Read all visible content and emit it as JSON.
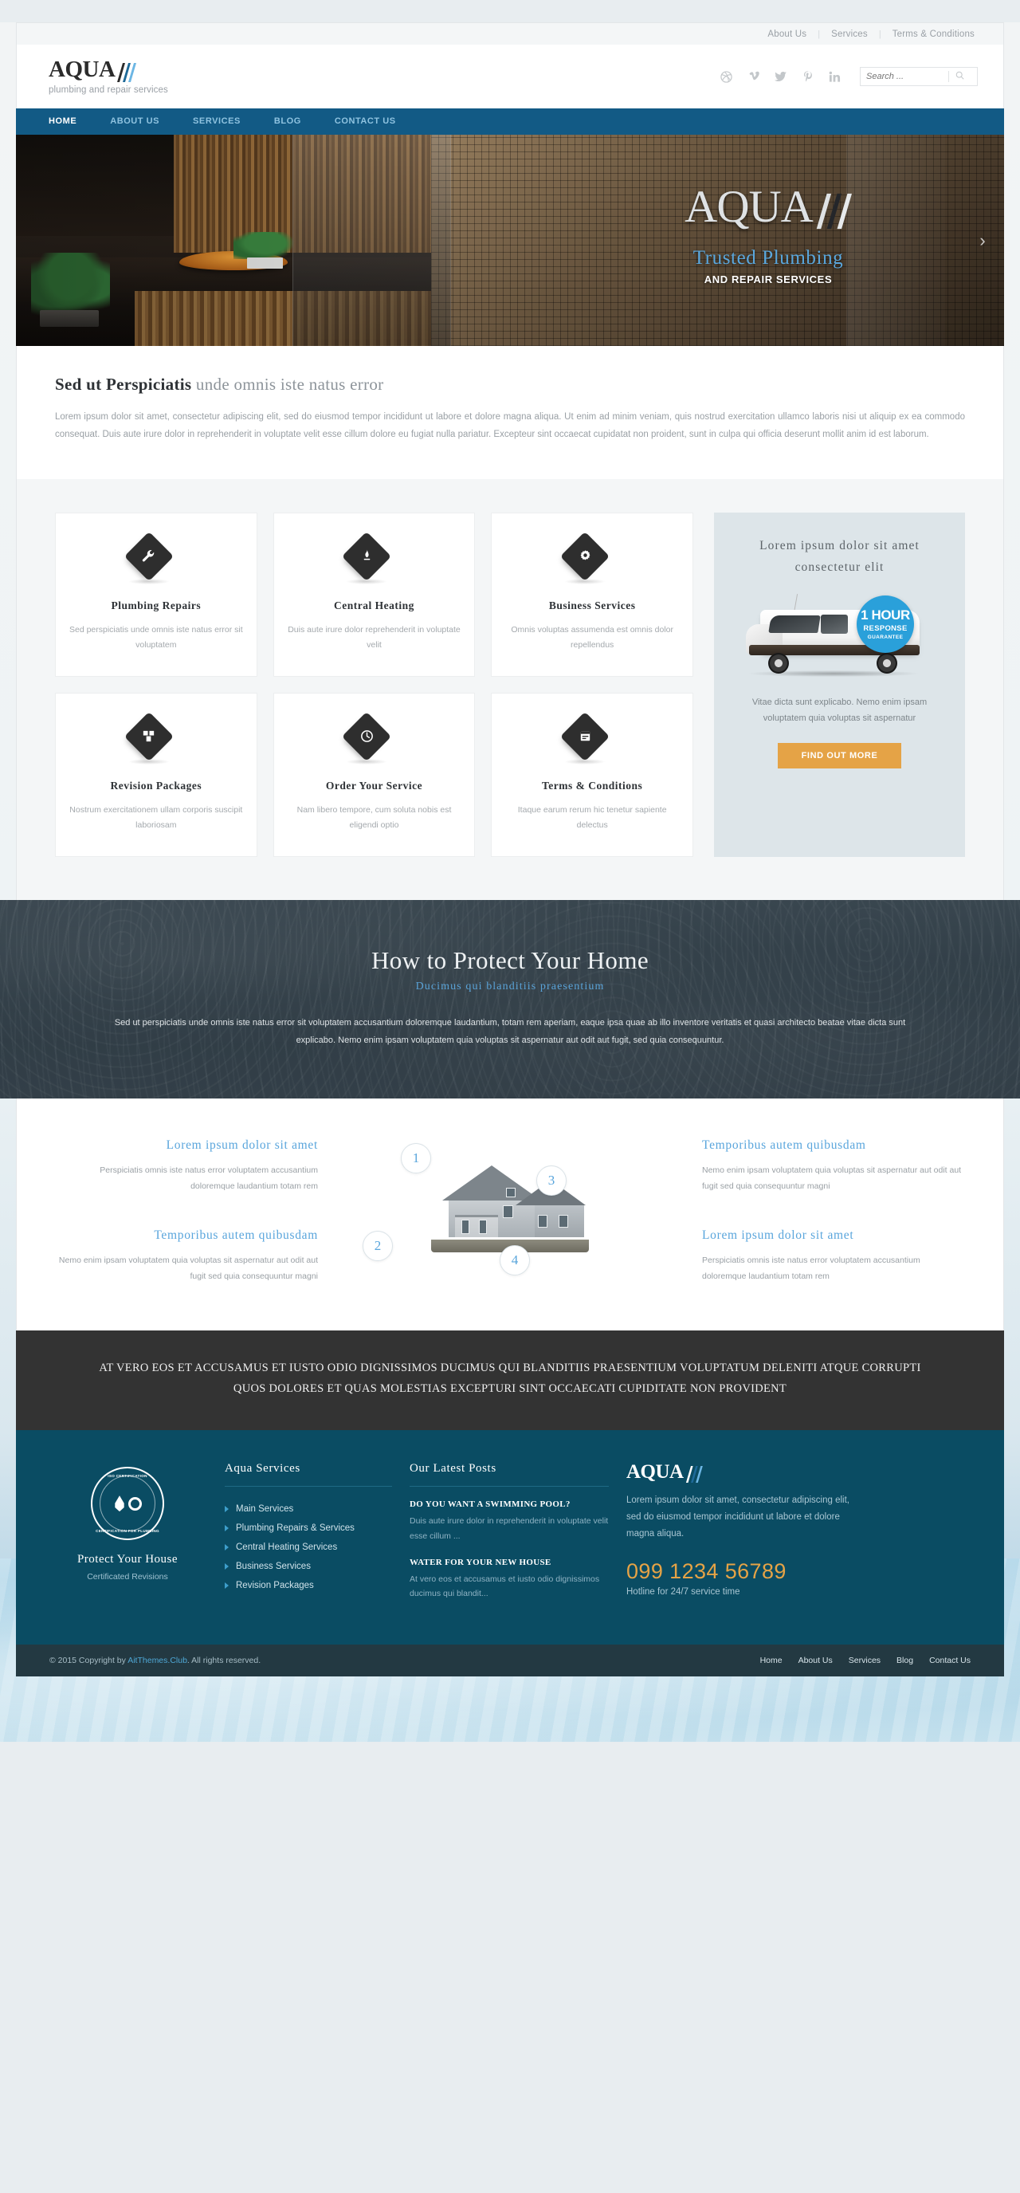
{
  "topbar": {
    "links": [
      "About Us",
      "Services",
      "Terms & Conditions"
    ]
  },
  "header": {
    "logo_text": "AQUA",
    "tagline": "plumbing and repair services",
    "social": [
      "dribbble-icon",
      "vimeo-icon",
      "twitter-icon",
      "pinterest-icon",
      "linkedin-icon"
    ],
    "search_placeholder": "Search ...",
    "search_value": ""
  },
  "nav": {
    "items": [
      {
        "label": "HOME",
        "active": true
      },
      {
        "label": "ABOUT US",
        "active": false
      },
      {
        "label": "SERVICES",
        "active": false
      },
      {
        "label": "BLOG",
        "active": false
      },
      {
        "label": "CONTACT US",
        "active": false
      }
    ]
  },
  "hero": {
    "logo_text": "AQUA",
    "headline": "Trusted Plumbing",
    "subhead": "AND REPAIR SERVICES",
    "next_arrow": "chevron-right-icon"
  },
  "intro": {
    "title_bold": "Sed ut Perspiciatis",
    "title_rest": " unde omnis iste natus error",
    "body": "Lorem ipsum dolor sit amet, consectetur adipiscing elit, sed do eiusmod tempor incididunt ut labore et dolore magna aliqua. Ut enim ad minim veniam, quis nostrud exercitation ullamco laboris nisi ut aliquip ex ea commodo consequat. Duis aute irure dolor in reprehenderit in voluptate velit esse cillum dolore eu fugiat nulla pariatur. Excepteur sint occaecat cupidatat non proident, sunt in culpa qui officia deserunt mollit anim id est laborum."
  },
  "services": {
    "cards": [
      {
        "icon": "wrench-icon",
        "title": "Plumbing Repairs",
        "text": "Sed perspiciatis unde omnis iste natus error sit voluptatem"
      },
      {
        "icon": "flame-icon",
        "title": "Central Heating",
        "text": "Duis aute irure dolor reprehenderit in voluptate velit"
      },
      {
        "icon": "gear-icon",
        "title": "Business Services",
        "text": "Omnis voluptas assumenda est omnis dolor repellendus"
      },
      {
        "icon": "puzzle-icon",
        "title": "Revision Packages",
        "text": "Nostrum exercitationem ullam corporis suscipit laboriosam"
      },
      {
        "icon": "clock-icon",
        "title": "Order Your Service",
        "text": "Nam libero tempore, cum soluta nobis est eligendi optio"
      },
      {
        "icon": "document-icon",
        "title": "Terms & Conditions",
        "text": "Itaque earum rerum hic tenetur sapiente delectus"
      }
    ]
  },
  "promo": {
    "title_line1": "Lorem ipsum dolor sit amet",
    "title_line2": "consectetur elit",
    "badge_line1": "1 HOUR",
    "badge_line2": "RESPONSE",
    "badge_line3": "GUARANTEE",
    "text": "Vitae dicta sunt explicabo. Nemo enim ipsam voluptatem quia voluptas sit aspernatur",
    "button": "FIND OUT MORE"
  },
  "dark_section": {
    "title": "How to Protect Your Home",
    "subtitle": "Ducimus qui blanditiis praesentium",
    "body": "Sed ut perspiciatis unde omnis iste natus error sit voluptatem accusantium doloremque laudantium, totam rem aperiam, eaque ipsa quae ab illo inventore veritatis et quasi architecto beatae vitae dicta sunt explicabo. Nemo enim ipsam voluptatem quia voluptas sit aspernatur aut odit aut fugit, sed quia consequuntur."
  },
  "house_section": {
    "left": [
      {
        "title": "Lorem ipsum dolor sit amet",
        "text": "Perspiciatis omnis iste natus error voluptatem accusantium doloremque laudantium totam rem"
      },
      {
        "title": "Temporibus autem quibusdam",
        "text": "Nemo enim ipsam voluptatem quia voluptas sit aspernatur aut odit aut fugit sed quia consequuntur magni"
      }
    ],
    "right": [
      {
        "title": "Temporibus autem quibusdam",
        "text": "Nemo enim ipsam voluptatem quia voluptas sit aspernatur aut odit aut fugit sed quia consequuntur magni"
      },
      {
        "title": "Lorem ipsum dolor sit amet",
        "text": "Perspiciatis omnis iste natus error voluptatem accusantium doloremque laudantium totam rem"
      }
    ],
    "markers": [
      "1",
      "2",
      "3",
      "4"
    ]
  },
  "quote_bar": {
    "text": "At vero eos et accusamus et iusto odio dignissimos ducimus qui blanditiis praesentium voluptatum deleniti atque corrupti quos dolores et quas molestias excepturi sint occaecati cupiditate non provident"
  },
  "footer": {
    "seal": {
      "top_text": "ISO CERTIFICATION",
      "bottom_text": "CERTIFICATION FOR PLUMBING",
      "title": "Protect Your House",
      "subtitle": "Certificated Revisions"
    },
    "services": {
      "heading": "Aqua Services",
      "items": [
        "Main Services",
        "Plumbing Repairs & Services",
        "Central Heating Services",
        "Business Services",
        "Revision Packages"
      ]
    },
    "posts": {
      "heading": "Our Latest Posts",
      "items": [
        {
          "title": "Do You Want a Swimming Pool?",
          "text": "Duis aute irure dolor in reprehenderit in voluptate velit esse cillum ..."
        },
        {
          "title": "Water for Your New House",
          "text": "At vero eos et accusamus et iusto odio dignissimos ducimus qui blandit..."
        }
      ]
    },
    "contact": {
      "logo_text": "AQUA",
      "about": "Lorem ipsum dolor sit amet, consectetur adipiscing elit, sed do eiusmod tempor incididunt ut labore et dolore magna aliqua.",
      "phone": "099 1234 56789",
      "phone_note": "Hotline for 24/7 service time"
    }
  },
  "copyright": {
    "prefix": "© 2015 Copyright by ",
    "brand": "AitThemes.Club",
    "suffix": ". All rights reserved.",
    "links": [
      "Home",
      "About Us",
      "Services",
      "Blog",
      "Contact Us"
    ]
  },
  "colors": {
    "nav_blue": "#125a85",
    "accent_blue": "#54a9dd",
    "orange": "#e5a346",
    "footer_blue": "#0a4c63",
    "dark": "#333333"
  }
}
